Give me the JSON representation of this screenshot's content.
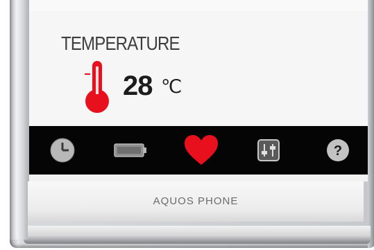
{
  "screen": {
    "temperature_label": "TEMPERATURE",
    "temperature_value": "28",
    "temperature_unit": "℃"
  },
  "icon_bar": {
    "items": [
      {
        "icon": "clock-icon",
        "color": "#c8c8c8"
      },
      {
        "icon": "battery-icon",
        "color": "#a9a9a9"
      },
      {
        "icon": "heart-icon",
        "color": "#e8101c"
      },
      {
        "icon": "settings-sliders-icon",
        "color": "#bdbdbd"
      },
      {
        "icon": "help-icon",
        "color": "#c8c8c8"
      }
    ]
  },
  "device": {
    "brand": "AQUOS PHONE"
  },
  "colors": {
    "thermometer": "#e8101c",
    "icon_bar_background": "#050505",
    "screen_background": "#f7f6f6"
  }
}
